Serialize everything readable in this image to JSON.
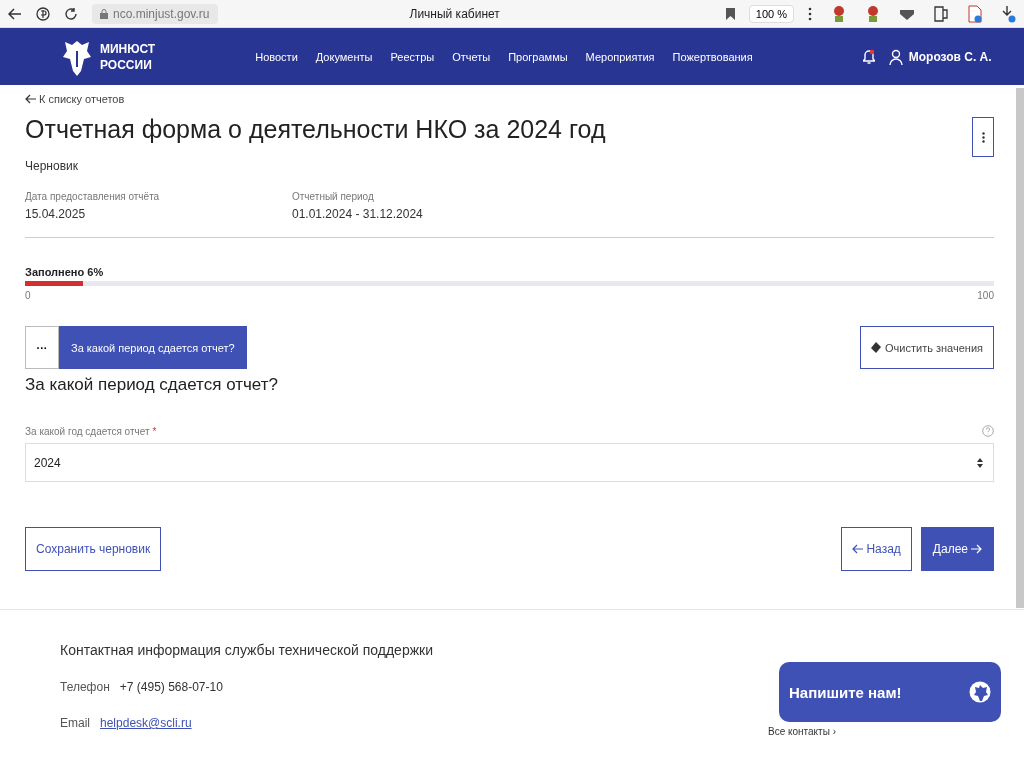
{
  "browser": {
    "address": "nco.minjust.gov.ru",
    "title": "Личный кабинет",
    "zoom": "100 %"
  },
  "header": {
    "logo_lines": [
      "МИНЮСТ",
      "РОССИИ"
    ],
    "nav": [
      "Новости",
      "Документы",
      "Реестры",
      "Отчеты",
      "Программы",
      "Мероприятия",
      "Пожертвования"
    ],
    "user": "Морозов С. А."
  },
  "back_link": "К списку отчетов",
  "title": "Отчетная форма о деятельности НКО за 2024 год",
  "status": "Черновик",
  "meta": [
    {
      "label": "Дата предоставления отчёта",
      "value": "15.04.2025"
    },
    {
      "label": "Отчетный период",
      "value": "01.01.2024 - 31.12.2024"
    }
  ],
  "progress": {
    "label": "Заполнено 6%",
    "level": 0.06,
    "min": "0",
    "max": "100"
  },
  "section_tab": {
    "dots": "···",
    "label": "За какой период сдается отчет?"
  },
  "clear_button": "Очистить значения",
  "section_title": "За какой период сдается отчет?",
  "field": {
    "label": "За какой год сдается отчет",
    "required_mark": "*",
    "value": "2024"
  },
  "buttons": {
    "save": "Сохранить черновик",
    "back": "Назад",
    "next": "Далее"
  },
  "footer": {
    "title": "Контактная информация службы технической поддержки",
    "phone_label": "Телефон",
    "phone": "+7 (495) 568-07-10",
    "email_label": "Email",
    "email": "helpdesk@scli.ru",
    "all_contacts": "Все контакты ›"
  },
  "chat_button": "Напишите нам!"
}
